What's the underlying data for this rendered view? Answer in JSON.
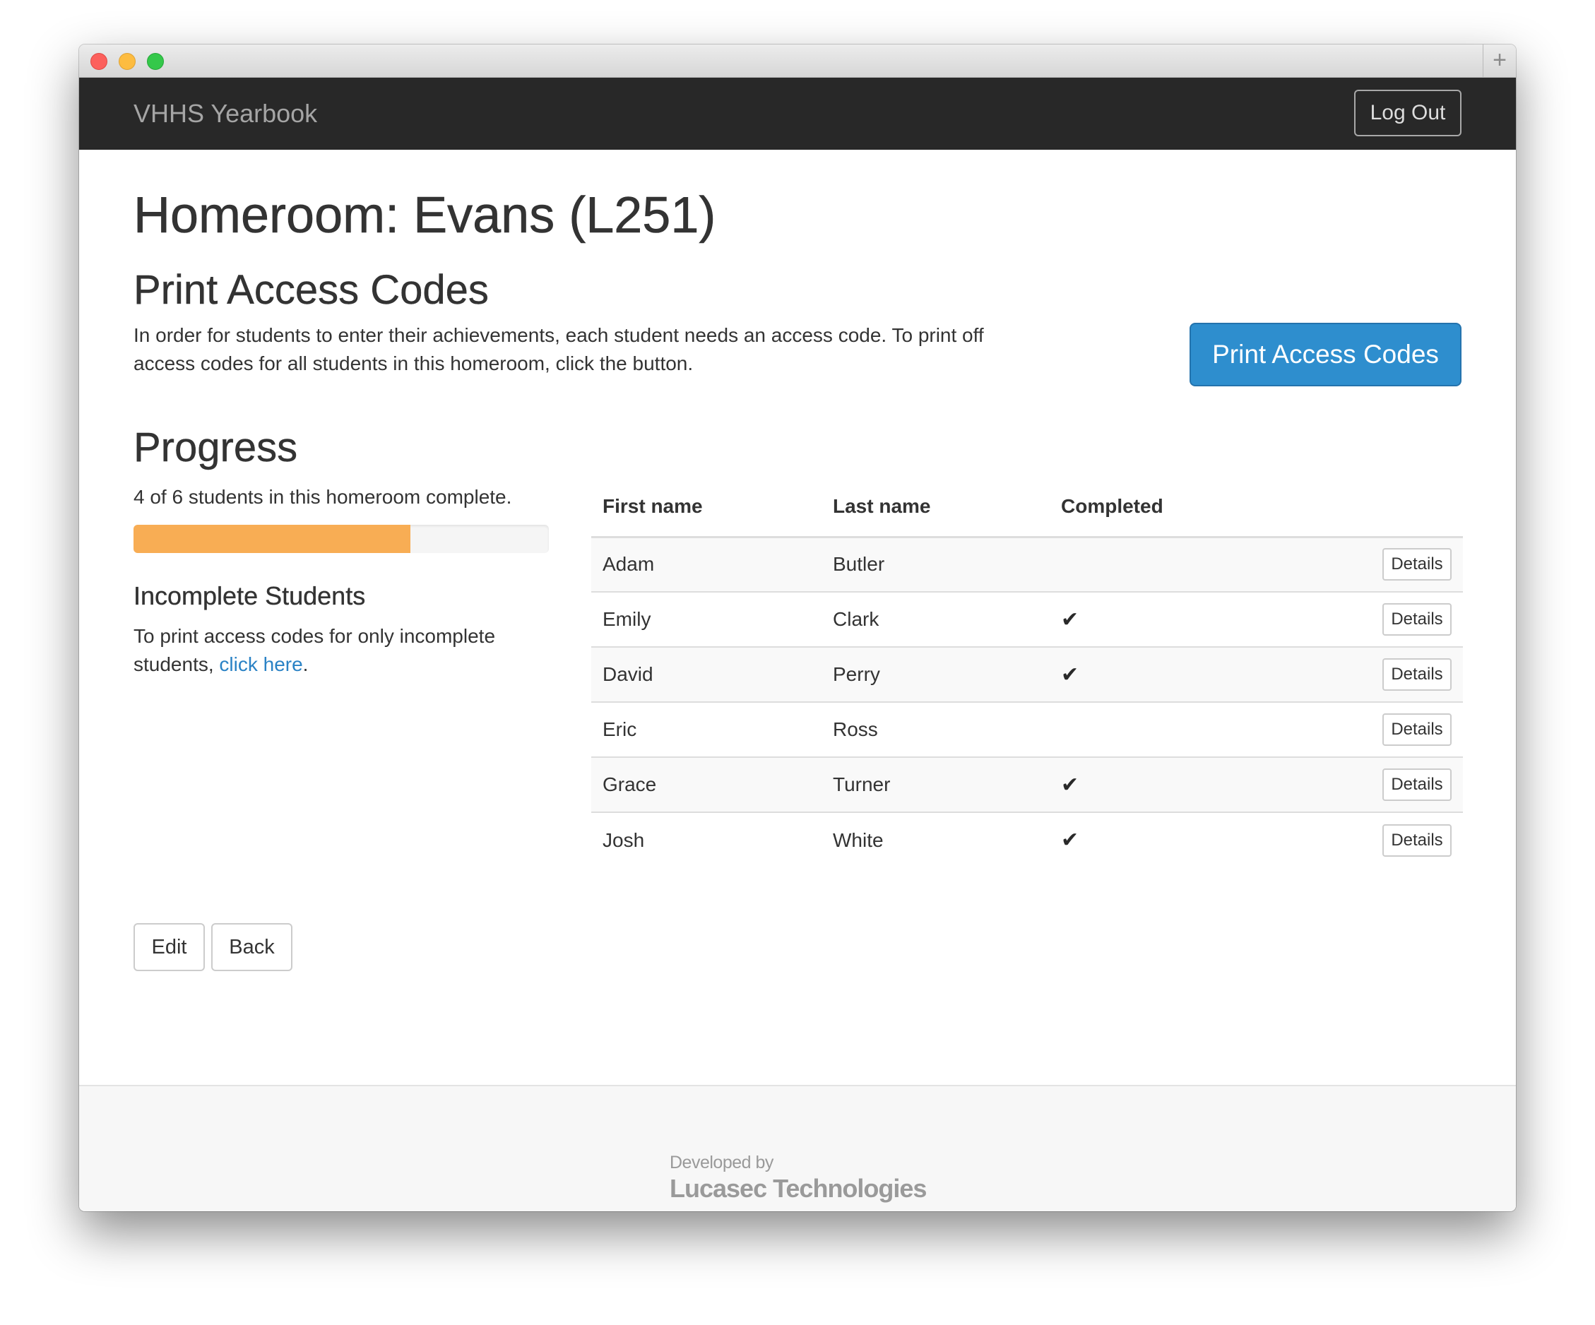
{
  "window": {
    "new_tab_icon": "+"
  },
  "navbar": {
    "brand": "VHHS Yearbook",
    "logout_label": "Log Out"
  },
  "page": {
    "title": "Homeroom: Evans (L251)"
  },
  "print_section": {
    "heading": "Print Access Codes",
    "description": "In order for students to enter their achievements, each student needs an access code. To print off access codes for all students in this homeroom, click the button.",
    "button_label": "Print Access Codes",
    "button_color": "#2e8ece"
  },
  "progress": {
    "heading": "Progress",
    "summary": "4 of 6 students in this homeroom complete.",
    "completed": 4,
    "total": 6,
    "bar_color": "#f8ad54"
  },
  "incomplete": {
    "heading": "Incomplete Students",
    "text_before": "To print access codes for only incomplete students, ",
    "link_label": "click here",
    "text_after": "."
  },
  "table": {
    "headers": [
      "First name",
      "Last name",
      "Completed",
      ""
    ],
    "check_icon": "✔",
    "details_label": "Details",
    "rows": [
      {
        "first": "Adam",
        "last": "Butler",
        "completed": false
      },
      {
        "first": "Emily",
        "last": "Clark",
        "completed": true
      },
      {
        "first": "David",
        "last": "Perry",
        "completed": true
      },
      {
        "first": "Eric",
        "last": "Ross",
        "completed": false
      },
      {
        "first": "Grace",
        "last": "Turner",
        "completed": true
      },
      {
        "first": "Josh",
        "last": "White",
        "completed": true
      }
    ]
  },
  "actions": {
    "edit_label": "Edit",
    "back_label": "Back"
  },
  "footer": {
    "developed_by": "Developed by",
    "company": "Lucasec Technologies"
  }
}
